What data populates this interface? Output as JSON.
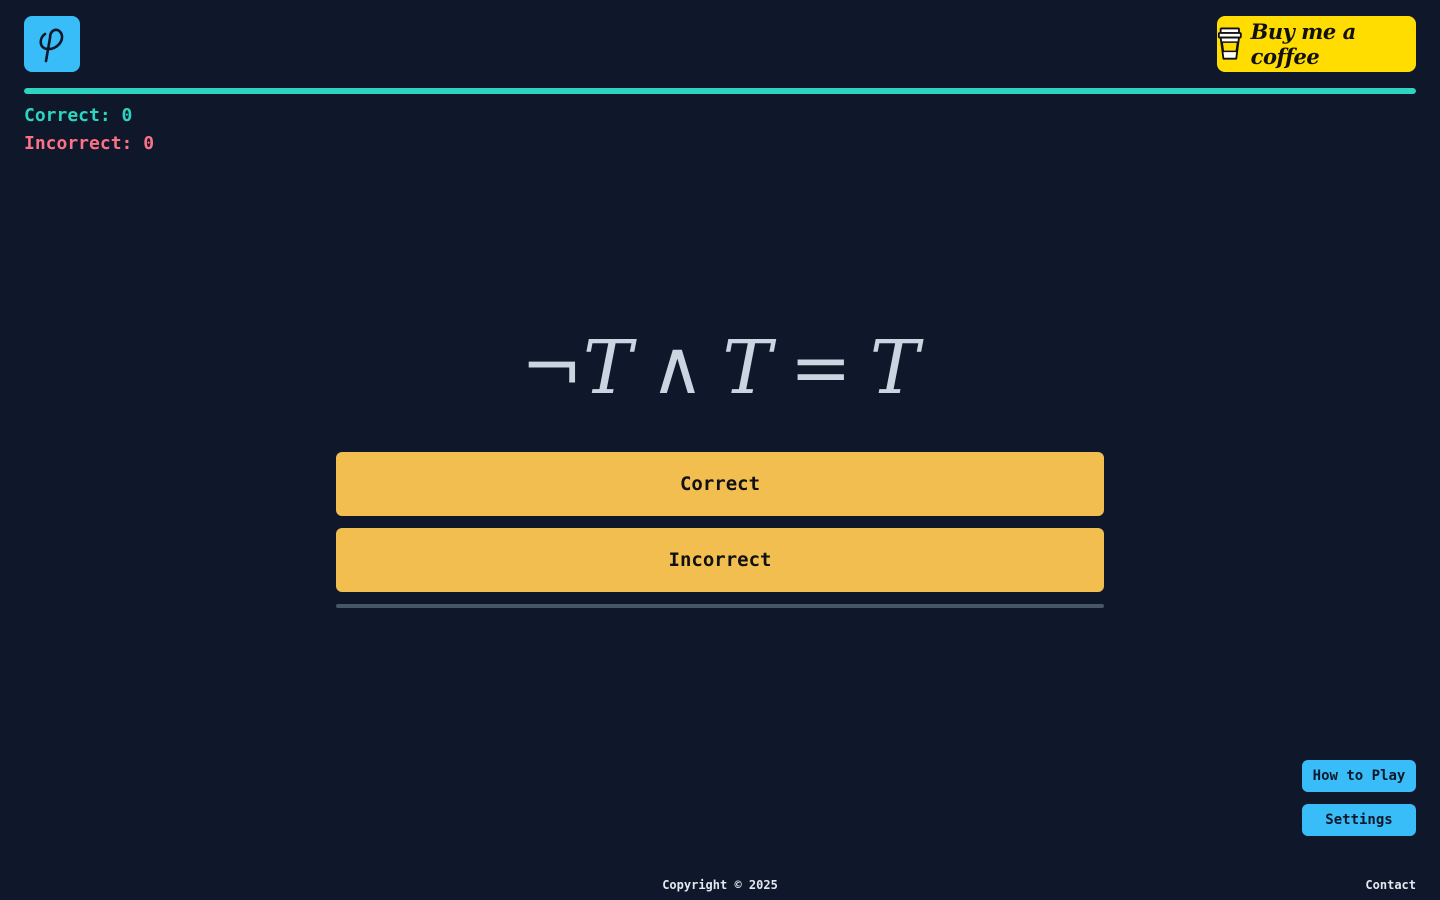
{
  "header": {
    "logo_icon": "phi-logo-icon",
    "logo_glyph": "φ",
    "coffee_button": {
      "label": "Buy me a coffee",
      "icon": "coffee-cup-icon",
      "color": "#ffdd00"
    }
  },
  "progress": {
    "value": 1.0,
    "color": "#2dd4bf"
  },
  "score": {
    "correct_label": "Correct: ",
    "correct_value": "0",
    "incorrect_label": "Incorrect: ",
    "incorrect_value": "0"
  },
  "question": {
    "negation": "¬",
    "lhs1": "T",
    "operator": "∧",
    "lhs2": "T",
    "equals": "=",
    "rhs": "T"
  },
  "answers": {
    "correct_label": "Correct",
    "incorrect_label": "Incorrect",
    "color": "#f3be50"
  },
  "timer": {
    "value": 1.0
  },
  "side_buttons": {
    "how_to_play": "How to Play",
    "settings": "Settings"
  },
  "footer": {
    "copyright": "Copyright © 2025",
    "contact": "Contact"
  },
  "colors": {
    "background": "#0f172a",
    "accent_blue": "#38bdf8",
    "correct_green": "#2dd4bf",
    "incorrect_red": "#fb7185"
  }
}
